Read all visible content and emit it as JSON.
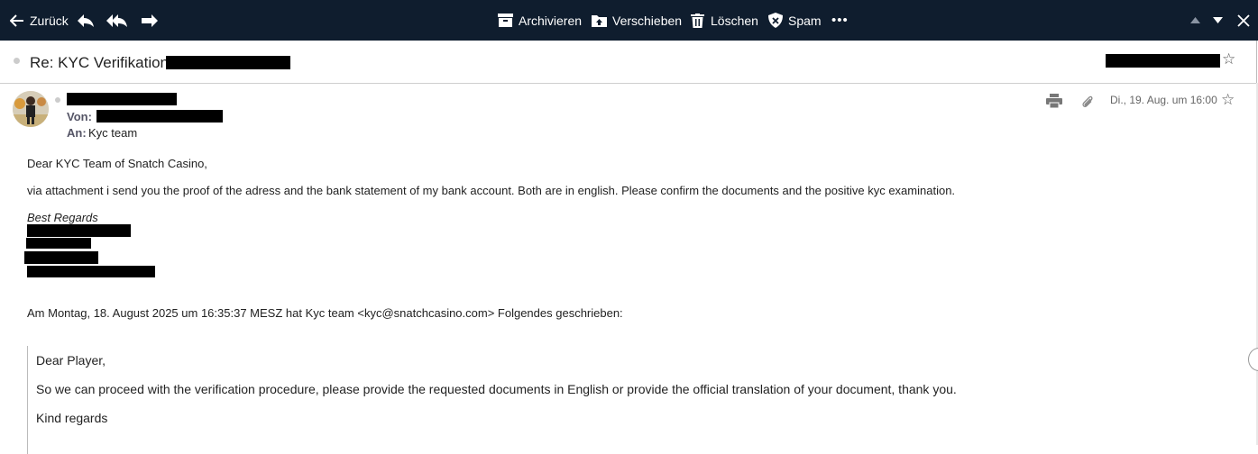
{
  "toolbar": {
    "back_label": "Zurück",
    "archive_label": "Archivieren",
    "move_label": "Verschieben",
    "delete_label": "Löschen",
    "spam_label": "Spam",
    "more_label": "•••"
  },
  "subject": {
    "text": "Re: KYC Verifikation"
  },
  "message": {
    "from_label": "Von:",
    "to_label": "An:",
    "to_value": "Kyc team",
    "date": "Di., 19. Aug. um 16:00"
  },
  "body": {
    "greeting": "Dear KYC Team of Snatch Casino,",
    "paragraph": "via attachment i send you the proof of the adress and the bank statement of my bank account. Both are in english. Please confirm the documents and the positive kyc examination.",
    "signoff": "Best Regards",
    "quote_header": "Am Montag, 18. August 2025 um 16:35:37 MESZ hat Kyc team <kyc@snatchcasino.com> Folgendes geschrieben:"
  },
  "quote": {
    "greeting": "Dear Player,",
    "paragraph": "So we can proceed with the verification procedure, please provide the requested documents in English or provide the official translation of your document, thank you.",
    "signoff": "Kind regards"
  },
  "colors": {
    "toolbar_bg": "#0f1d2e",
    "toolbar_fg": "#ffffff",
    "redaction": "#000000"
  }
}
